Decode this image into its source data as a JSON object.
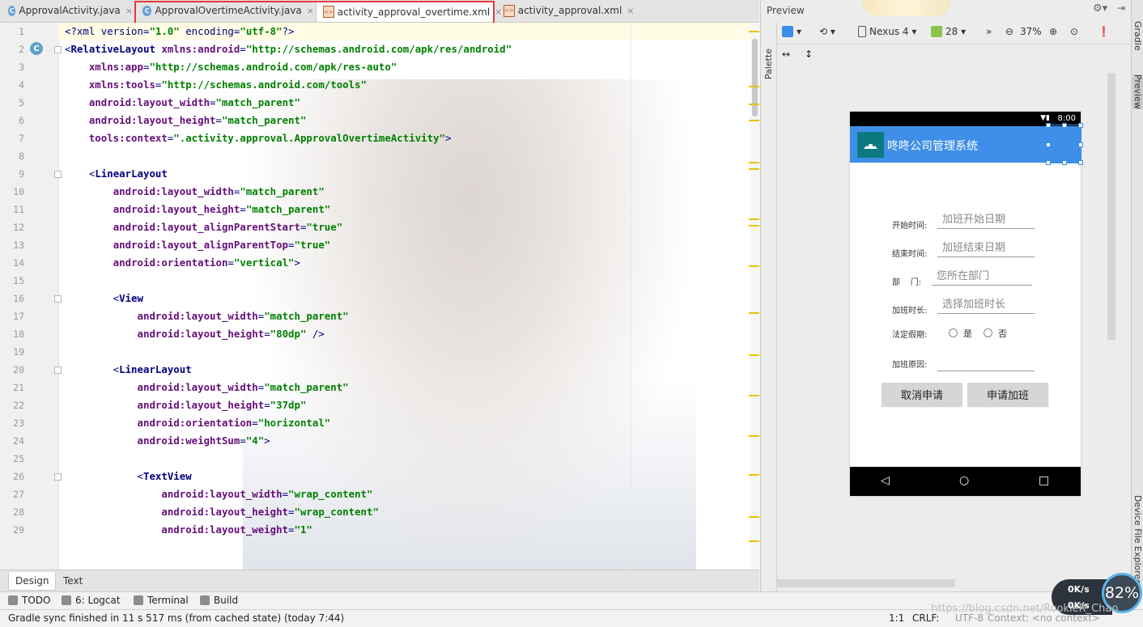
{
  "tabs": [
    {
      "label": "ApprovalActivity.java",
      "kind": "java"
    },
    {
      "label": "ApprovalOvertimeActivity.java",
      "kind": "java"
    },
    {
      "label": "activity_approval_overtime.xml",
      "kind": "xml",
      "active": true
    },
    {
      "label": "activity_approval.xml",
      "kind": "xml"
    }
  ],
  "editor": {
    "lines": [
      {
        "n": "1",
        "text": "<?xml version=\"1.0\" encoding=\"utf-8\"?>"
      },
      {
        "n": "2",
        "text": "<RelativeLayout xmlns:android=\"http://schemas.android.com/apk/res/android\""
      },
      {
        "n": "3",
        "text": "    xmlns:app=\"http://schemas.android.com/apk/res-auto\""
      },
      {
        "n": "4",
        "text": "    xmlns:tools=\"http://schemas.android.com/tools\""
      },
      {
        "n": "5",
        "text": "    android:layout_width=\"match_parent\""
      },
      {
        "n": "6",
        "text": "    android:layout_height=\"match_parent\""
      },
      {
        "n": "7",
        "text": "    tools:context=\".activity.approval.ApprovalOvertimeActivity\">"
      },
      {
        "n": "8",
        "text": ""
      },
      {
        "n": "9",
        "text": "    <LinearLayout"
      },
      {
        "n": "10",
        "text": "        android:layout_width=\"match_parent\""
      },
      {
        "n": "11",
        "text": "        android:layout_height=\"match_parent\""
      },
      {
        "n": "12",
        "text": "        android:layout_alignParentStart=\"true\""
      },
      {
        "n": "13",
        "text": "        android:layout_alignParentTop=\"true\""
      },
      {
        "n": "14",
        "text": "        android:orientation=\"vertical\">"
      },
      {
        "n": "15",
        "text": ""
      },
      {
        "n": "16",
        "text": "        <View"
      },
      {
        "n": "17",
        "text": "            android:layout_width=\"match_parent\""
      },
      {
        "n": "18",
        "text": "            android:layout_height=\"80dp\" />"
      },
      {
        "n": "19",
        "text": ""
      },
      {
        "n": "20",
        "text": "        <LinearLayout"
      },
      {
        "n": "21",
        "text": "            android:layout_width=\"match_parent\""
      },
      {
        "n": "22",
        "text": "            android:layout_height=\"37dp\""
      },
      {
        "n": "23",
        "text": "            android:orientation=\"horizontal\""
      },
      {
        "n": "24",
        "text": "            android:weightSum=\"4\">"
      },
      {
        "n": "25",
        "text": ""
      },
      {
        "n": "26",
        "text": "            <TextView"
      },
      {
        "n": "27",
        "text": "                android:layout_width=\"wrap_content\""
      },
      {
        "n": "28",
        "text": "                android:layout_height=\"wrap_content\""
      },
      {
        "n": "29",
        "text": "                android:layout_weight=\"1\""
      }
    ]
  },
  "editor_mode_tabs": [
    "Design",
    "Text"
  ],
  "tool_windows": [
    "TODO",
    "6: Logcat",
    "Terminal",
    "Build"
  ],
  "status": {
    "message": "Gradle sync finished in 11 s 517 ms (from cached state) (today 7:44)",
    "position": "1:1",
    "line_sep": "CRLF:",
    "encoding": "UTF-8",
    "context": "Context: <no context>"
  },
  "preview": {
    "title": "Preview",
    "palette_label": "Palette",
    "device": "Nexus 4",
    "api": "28",
    "zoom": "37%",
    "phone": {
      "time": "8:00",
      "app_title": "咚咚公司管理系统",
      "fields": [
        {
          "label": "开始时间:",
          "hint": "加班开始日期"
        },
        {
          "label": "结束时间:",
          "hint": "加班结束日期"
        },
        {
          "label": "部    门:",
          "hint": "您所在部门"
        },
        {
          "label": "加班时长:",
          "hint": "选择加班时长"
        }
      ],
      "holiday_label": "法定假期:",
      "radio_yes": "是",
      "radio_no": "否",
      "reason_label": "加班原因:",
      "cancel_button": "取消申请",
      "submit_button": "申请加班"
    }
  },
  "right_strip": {
    "gradle": "Gradle",
    "preview": "Preview",
    "device_file_explorer": "Device File Explorer"
  },
  "net_meter": {
    "up": "0K/s",
    "down": "0K/s",
    "percent": "82%"
  },
  "watermark": "https://blog.csdn.net/RookieR_Chao"
}
